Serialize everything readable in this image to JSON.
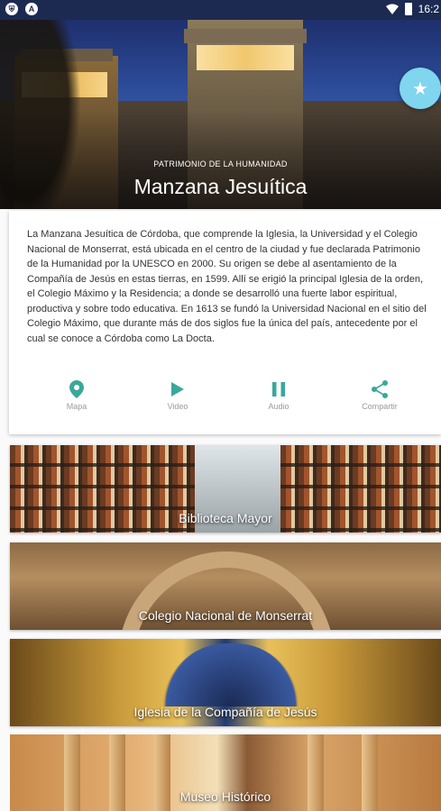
{
  "status_bar": {
    "left_icons": [
      "shield-icon",
      "a-icon"
    ],
    "time": "16:2",
    "right_icons": [
      "wifi-icon",
      "battery-icon"
    ]
  },
  "hero": {
    "kicker": "PATRIMONIO DE LA HUMANIDAD",
    "title": "Manzana Jesuítica"
  },
  "fab": {
    "icon": "star-icon"
  },
  "description": "La Manzana Jesuítica de Córdoba, que comprende la Iglesia, la Universidad y el Colegio Nacional de Monserrat, está ubicada en el centro de la ciudad y fue declarada Patrimonio de la Humanidad por la UNESCO en 2000. Su origen se debe al asentamiento de la Compañía de Jesús en estas tierras, en 1599. Allí se erigió la principal Iglesia de la orden, el Colegio Máximo y la Residencia; a donde se desarrolló una fuerte labor espiritual, productiva y sobre todo educativa. En 1613 se fundó la Universidad Nacional en el sitio del Colegio Máximo, que durante más de dos siglos fue la única del país, antecedente por el cual se conoce a Córdoba como La Docta.",
  "actions": [
    {
      "label": "Mapa",
      "icon": "map-pin-icon"
    },
    {
      "label": "Video",
      "icon": "play-icon"
    },
    {
      "label": "Audio",
      "icon": "pause-icon"
    },
    {
      "label": "Compartir",
      "icon": "share-icon"
    }
  ],
  "places": [
    {
      "label": "Biblioteca Mayor"
    },
    {
      "label": "Colegio Nacional de Monserrat"
    },
    {
      "label": "Iglesia de la Compañía de Jesús"
    },
    {
      "label": "Museo Histórico"
    }
  ],
  "colors": {
    "accent": "#3aa89a",
    "fab": "#7fd6ee",
    "status_bar": "#1c2a52"
  }
}
